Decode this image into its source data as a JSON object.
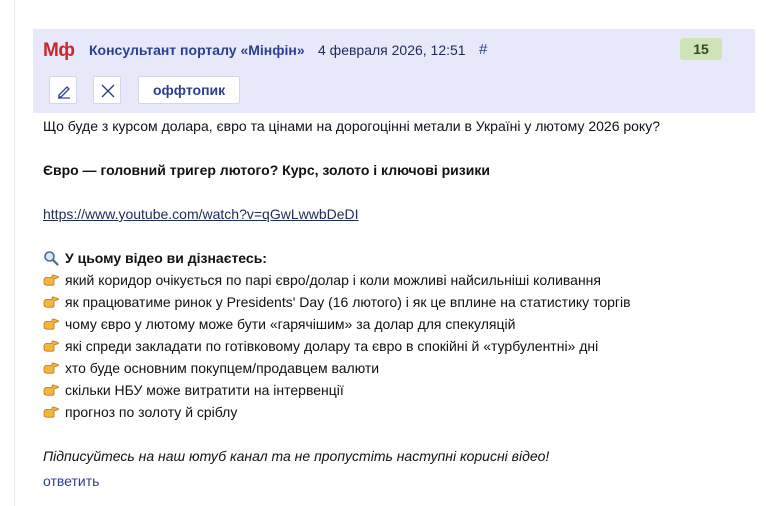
{
  "header": {
    "logo_text": "Мф",
    "author": "Консультант порталу «Мінфін»",
    "date": "4 февраля 2026, 12:51",
    "anchor": "#",
    "score": "15",
    "colors": {
      "header_bg": "#e7e9fb",
      "logo": "#c9262d",
      "link": "#2b3f8f",
      "score_bg": "#cfe3b8"
    }
  },
  "toolbar": {
    "edit_icon": "pencil-icon",
    "delete_icon": "close-icon",
    "tag_label": "оффтопик"
  },
  "content": {
    "line1": "Що буде з курсом долара, євро та цінами на дорогоцінні метали в Україні у лютому 2026 року?",
    "heading": "Євро — головний тригер лютого? Курс, золото і ключові ризики",
    "link": "https://www.youtube.com/watch?v=qGwLwwbDeDI",
    "intro": "У цьому відео ви дізнаєтесь:",
    "intro_icon": "magnifier-icon",
    "bullet_icon": "pointing-hand-icon",
    "bullets": [
      "який коридор очікується по парі євро/долар і коли можливі найсильніші коливання",
      "як працюватиме ринок у Presidents' Day (16 лютого) і як це вплине на статистику торгів",
      "чому євро у лютому може бути «гарячішим» за долар для спекуляцій",
      "які спреди закладати по готівковому долару та євро в спокійні й «турбулентні» дні",
      "хто буде основним покупцем/продавцем валюти",
      "скільки НБУ може витратити на інтервенції",
      "прогноз по золоту й сріблу"
    ],
    "closing": "Підписуйтесь на наш ютуб канал та не пропустіть наступні корисні відео!"
  },
  "actions": {
    "reply_label": "ответить"
  }
}
